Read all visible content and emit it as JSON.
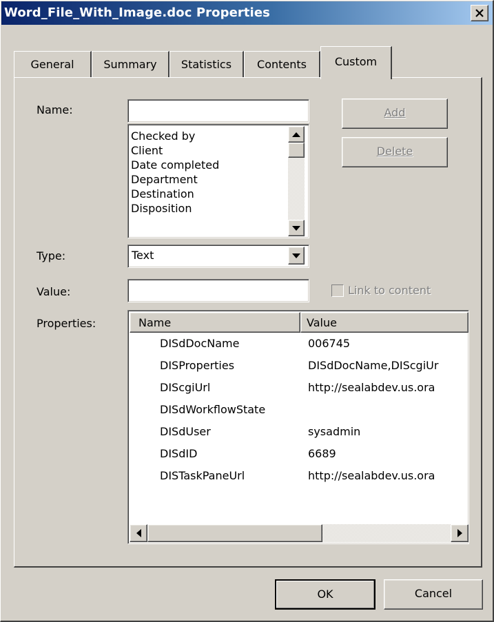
{
  "window": {
    "title": "Word_File_With_Image.doc Properties"
  },
  "tabs": [
    {
      "label": "General"
    },
    {
      "label": "Summary"
    },
    {
      "label": "Statistics"
    },
    {
      "label": "Contents"
    },
    {
      "label": "Custom",
      "active": true
    }
  ],
  "custom": {
    "name_label": "Name:",
    "name_value": "",
    "name_list": [
      "Checked by",
      "Client",
      "Date completed",
      "Department",
      "Destination",
      "Disposition"
    ],
    "type_label": "Type:",
    "type_value": "Text",
    "value_label": "Value:",
    "value_value": "",
    "link_to_content_label": "Link to content",
    "link_to_content_checked": false,
    "properties_label": "Properties:",
    "add_label": "Add",
    "delete_label": "Delete",
    "properties_table": {
      "columns": [
        "Name",
        "Value"
      ],
      "rows": [
        {
          "name": "DISdDocName",
          "value": "006745"
        },
        {
          "name": "DISProperties",
          "value": "DISdDocName,DIScgiUr"
        },
        {
          "name": "DIScgiUrl",
          "value": "http://sealabdev.us.ora"
        },
        {
          "name": "DISdWorkflowState",
          "value": ""
        },
        {
          "name": "DISdUser",
          "value": "sysadmin"
        },
        {
          "name": "DISdID",
          "value": "6689"
        },
        {
          "name": "DISTaskPaneUrl",
          "value": "http://sealabdev.us.ora"
        }
      ]
    }
  },
  "footer": {
    "ok_label": "OK",
    "cancel_label": "Cancel"
  },
  "colors": {
    "title_gradient_start": "#0a246a",
    "title_gradient_end": "#a6caf0",
    "face": "#d4d0c8"
  }
}
